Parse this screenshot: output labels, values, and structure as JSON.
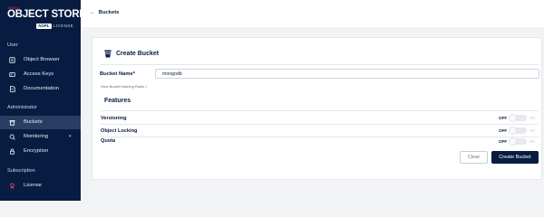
{
  "logo": {
    "brand": "MINIO",
    "name": "OBJECT STORE",
    "badge": "AGPL",
    "license": "LICENSE"
  },
  "sidebar": {
    "sections": {
      "user": "User",
      "administrator": "Administrator",
      "subscription": "Subscription"
    },
    "items": [
      {
        "label": "Object Browser",
        "icon": "object-browser-icon"
      },
      {
        "label": "Access Keys",
        "icon": "access-keys-icon"
      },
      {
        "label": "Documentation",
        "icon": "documentation-icon"
      },
      {
        "label": "Buckets",
        "icon": "buckets-icon",
        "active": true
      },
      {
        "label": "Monitoring",
        "icon": "monitoring-icon",
        "expandable": true
      },
      {
        "label": "Encryption",
        "icon": "encryption-icon"
      },
      {
        "label": "License",
        "icon": "license-icon"
      }
    ]
  },
  "header": {
    "back_label": "Buckets",
    "back_icon": "arrow-left-icon"
  },
  "form": {
    "title": "Create Bucket",
    "bucket_name_label": "Bucket Name*",
    "bucket_name_value": "mongodb",
    "naming_rules_link": "View Bucket Naming Rules",
    "features_heading": "Features",
    "features": [
      {
        "label": "Versioning",
        "off_label": "OFF",
        "on_label": "ON",
        "enabled": false
      },
      {
        "label": "Object Locking",
        "off_label": "OFF",
        "on_label": "ON",
        "enabled": false
      },
      {
        "label": "Quota",
        "off_label": "OFF",
        "on_label": "ON",
        "enabled": false
      }
    ],
    "clear_label": "Clear",
    "create_label": "Create Bucket"
  },
  "colors": {
    "sidebar_bg": "#081c42",
    "accent": "#081c42",
    "brand_red": "#c51c3c"
  }
}
